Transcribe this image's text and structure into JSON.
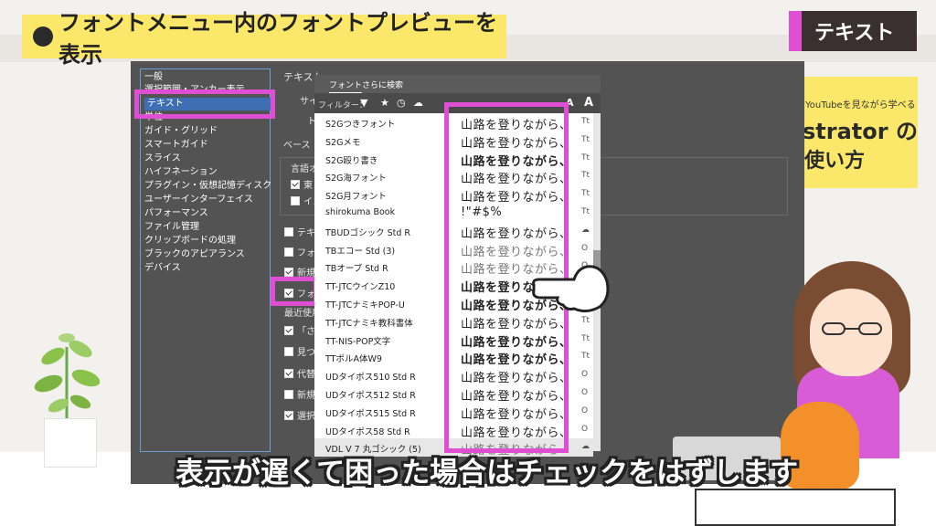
{
  "banner": {
    "title": "フォントメニュー内のフォントプレビューを表示"
  },
  "tag": {
    "label": "テキスト"
  },
  "promo": {
    "small": "YouTubeを見ながら学べる",
    "big": "strator の",
    "big2": "使い方"
  },
  "prefs": {
    "heading": "テキスト",
    "sidebar": [
      {
        "label": "一般"
      },
      {
        "label": "選択範囲・アンカー表示"
      },
      {
        "label": "テキスト",
        "selected": true
      },
      {
        "label": "単位"
      },
      {
        "label": "ガイド・グリッド"
      },
      {
        "label": "スマートガイド"
      },
      {
        "label": "スライス"
      },
      {
        "label": "ハイフネーション"
      },
      {
        "label": "プラグイン・仮想記憶ディスク"
      },
      {
        "label": "ユーザーインターフェイス"
      },
      {
        "label": "パフォーマンス"
      },
      {
        "label": "ファイル管理"
      },
      {
        "label": "クリップボードの処理"
      },
      {
        "label": "ブラックのアピアランス"
      },
      {
        "label": "デバイス"
      }
    ],
    "row_size": "サイ",
    "row_tracking": "ト",
    "baseline": "ベース",
    "lang_options": "言語オ",
    "east_asian": "東",
    "indic": "イン",
    "options": [
      {
        "label": "テキ",
        "checked": false
      },
      {
        "label": "フォ",
        "checked": false
      },
      {
        "label": "新規",
        "checked": true
      },
      {
        "label": "フォ",
        "checked": true
      }
    ],
    "recent_label": "最近使用",
    "more_options": [
      {
        "label": "「さら",
        "checked": true
      },
      {
        "label": "見つ",
        "checked": false
      },
      {
        "label": "代替",
        "checked": true
      },
      {
        "label": "新規",
        "checked": false
      },
      {
        "label": "選択さ",
        "checked": true
      }
    ]
  },
  "font_menu": {
    "tabs": [
      "フォント",
      "さらに検索"
    ],
    "filter_label": "フィルター：",
    "fonts": [
      {
        "name": "S2Gつきフォント",
        "sample": "山路を登りながら、",
        "style": "normal",
        "type": "Tt"
      },
      {
        "name": "S2Gメモ",
        "sample": "山路を登りながら、",
        "style": "normal",
        "type": "Tt"
      },
      {
        "name": "S2G殴り書き",
        "sample": "山路を登りながら、",
        "style": "bold",
        "type": "Tt"
      },
      {
        "name": "S2G海フォント",
        "sample": "山路を登りながら、",
        "style": "normal",
        "type": "Tt"
      },
      {
        "name": "S2G月フォント",
        "sample": "山路を登りながら、",
        "style": "normal",
        "type": "Tt"
      },
      {
        "name": "shirokuma Book",
        "sample": "!\"#$%",
        "style": "normal",
        "type": "Tt"
      },
      {
        "name": "TBUDゴシック Std R",
        "sample": "山路を登りながら、",
        "style": "normal",
        "type": "cloud"
      },
      {
        "name": "TBエコー Std (3)",
        "sample": "山路を登りながら、",
        "style": "light",
        "type": "O"
      },
      {
        "name": "TBオーブ Std R",
        "sample": "山路を登りながら、",
        "style": "light",
        "type": "O"
      },
      {
        "name": "TT-JTCウインZ10",
        "sample": "山路を登りながら、",
        "style": "bold",
        "type": "Tt"
      },
      {
        "name": "TT-JTCナミキPOP-U",
        "sample": "山路を登りながら、",
        "style": "bold",
        "type": "Tt"
      },
      {
        "name": "TT-JTCナミキ教科書体",
        "sample": "山路を登りながら、",
        "style": "normal",
        "type": "Tt"
      },
      {
        "name": "TT-NIS-POP文字",
        "sample": "山路を登りながら、",
        "style": "bold",
        "type": "Tt"
      },
      {
        "name": "TTポルA体W9",
        "sample": "山路を登りながら、",
        "style": "bold",
        "type": "Tt"
      },
      {
        "name": "UDタイポス510 Std R",
        "sample": "山路を登りながら、",
        "style": "normal",
        "type": "O"
      },
      {
        "name": "UDタイポス512 Std R",
        "sample": "山路を登りながら、",
        "style": "normal",
        "type": "O"
      },
      {
        "name": "UDタイポス515 Std R",
        "sample": "山路を登りながら、",
        "style": "normal",
        "type": "O"
      },
      {
        "name": "UDタイポス58 Std R",
        "sample": "山路を登りながら、",
        "style": "normal",
        "type": "O"
      },
      {
        "name": "VDL V 7 丸ゴシック (5)",
        "sample": "山路を登りながら",
        "style": "light",
        "type": "cloud"
      }
    ]
  },
  "caption": {
    "text": "表示が遅くて困った場合はチェックをはずします"
  },
  "colors": {
    "accent": "#e04fd3",
    "banner": "#fbe86a",
    "window": "#535353",
    "selection": "#3e6fb4"
  }
}
